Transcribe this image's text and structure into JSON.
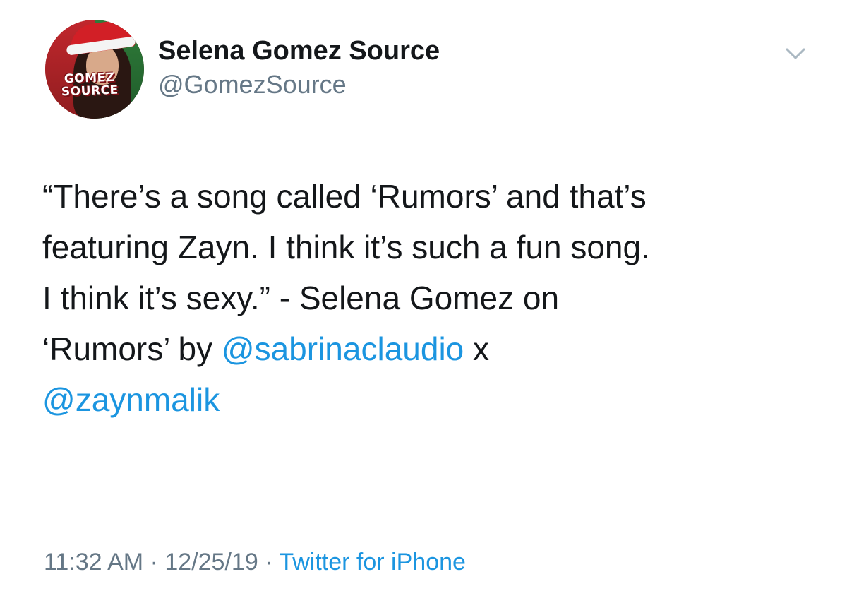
{
  "author": {
    "name": "Selena Gomez Source",
    "handle": "@GomezSource",
    "avatar_logo_line1": "GOMEZ",
    "avatar_logo_line2": "SOURCE"
  },
  "tweet": {
    "line1": "“There’s a song called ‘Rumors’ and that’s",
    "line2": "featuring Zayn. I think it’s such a fun song.",
    "line3": "I think it’s sexy.” - Selena Gomez on",
    "line4_text": "‘Rumors’ by ",
    "mention1": "@sabrinaclaudio",
    "line4_suffix": " x",
    "mention2": "@zaynmalik"
  },
  "meta": {
    "time": "11:32 AM",
    "separator": "·",
    "date": "12/25/19",
    "source": "Twitter for iPhone"
  },
  "icons": {
    "menu": "chevron-down-icon"
  },
  "colors": {
    "text": "#14171a",
    "secondary": "#657786",
    "link": "#1b95e0"
  }
}
